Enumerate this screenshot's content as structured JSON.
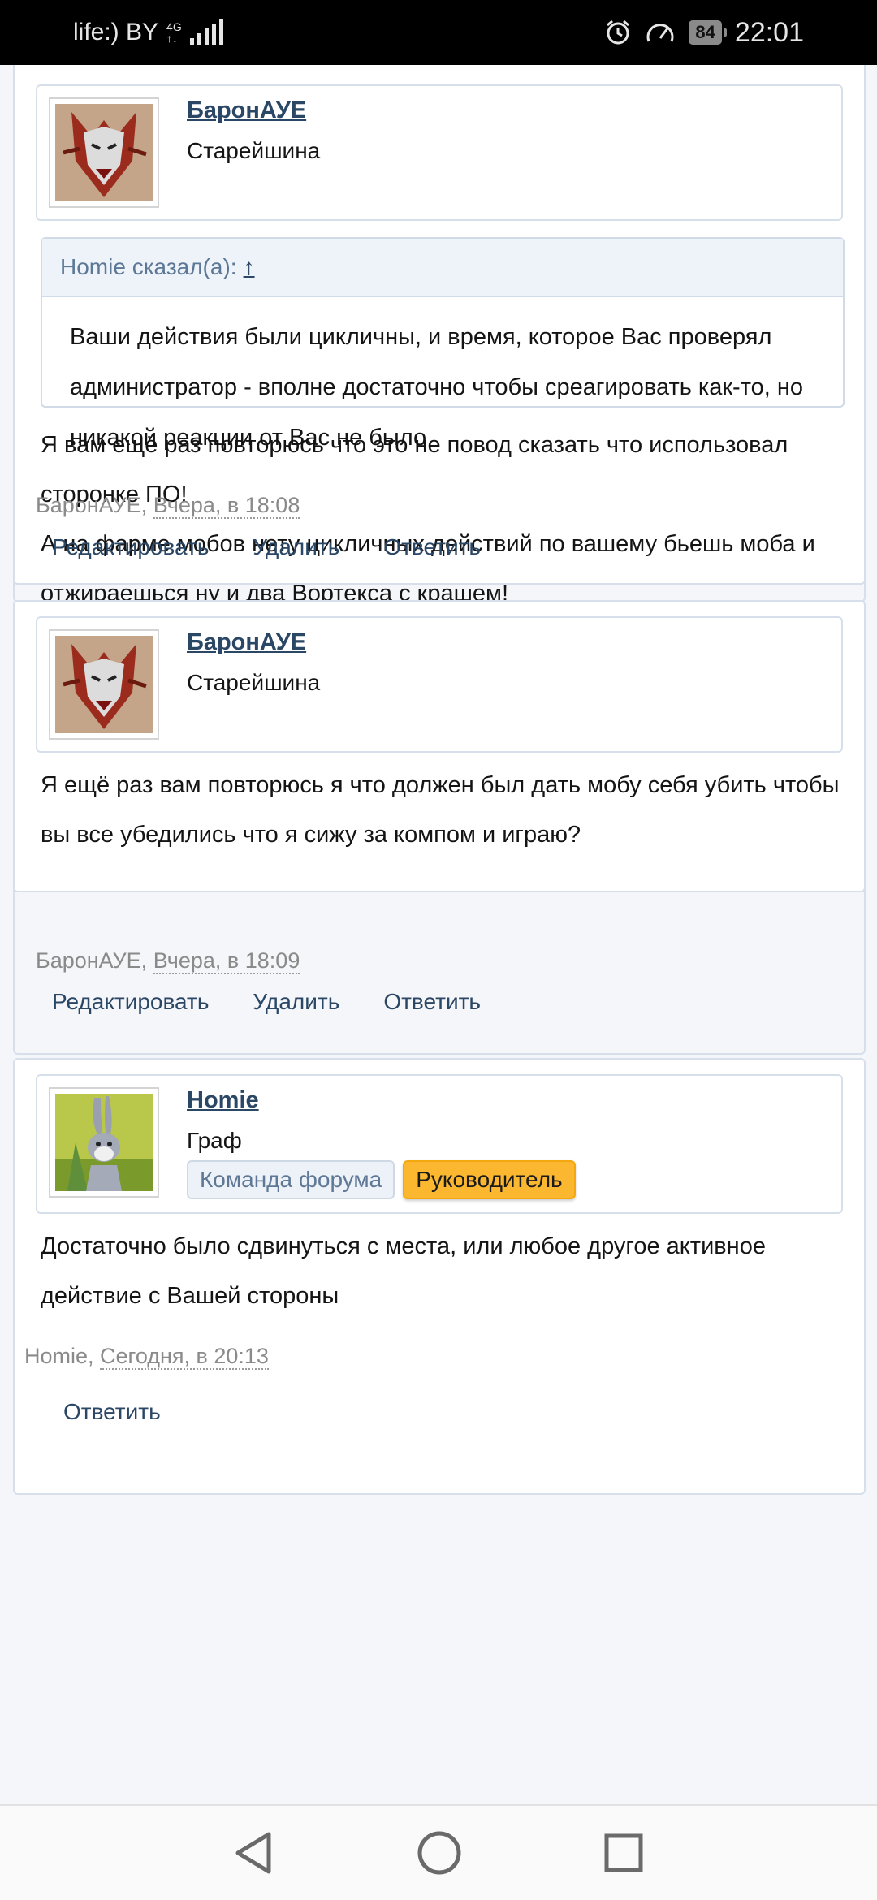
{
  "status_bar": {
    "carrier": "life:) BY",
    "network_top": "4G",
    "network_bottom": "↑↓",
    "battery": "84",
    "time": "22:01"
  },
  "posts": [
    {
      "author": "БаронАУЕ",
      "rank": "Старейшина",
      "quote": {
        "header": "Homie сказал(а):",
        "arrow": "↑",
        "text": "Ваши действия были цикличны, и время, которое Вас проверял администратор - вполне достаточно чтобы среагировать как-то, но никакой реакции от Вас не было"
      },
      "message_lines": [
        "Я вам ещё раз повторюсь что это не повод сказать что использовал сторонке ПО!",
        "А на фарме мобов нету цикличных действий по вашему бьешь моба и отжираешься ну и два Вортекса с крашем!"
      ],
      "meta_author": "БаронАУЕ,",
      "meta_date": "Вчера, в 18:08",
      "actions": [
        "Редактировать",
        "Удалить",
        "Ответить"
      ]
    },
    {
      "author": "БаронАУЕ",
      "rank": "Старейшина",
      "message": "Я ещё раз вам повторюсь я что должен был дать мобу себя убить чтобы вы все убедились что я сижу за компом и играю?",
      "meta_author": "БаронАУЕ,",
      "meta_date": "Вчера, в 18:09",
      "actions": [
        "Редактировать",
        "Удалить",
        "Ответить"
      ]
    },
    {
      "author": "Homie",
      "rank": "Граф",
      "badges": [
        "Команда форума",
        "Руководитель"
      ],
      "message": "Достаточно было сдвинуться с места, или любое другое активное действие с Вашей стороны",
      "meta_author": "Homie,",
      "meta_date": "Сегодня, в 20:13",
      "actions": [
        "Ответить"
      ]
    }
  ],
  "nav": {
    "back_icon": "back-triangle-icon",
    "home_icon": "home-circle-icon",
    "recent_icon": "recent-square-icon"
  }
}
